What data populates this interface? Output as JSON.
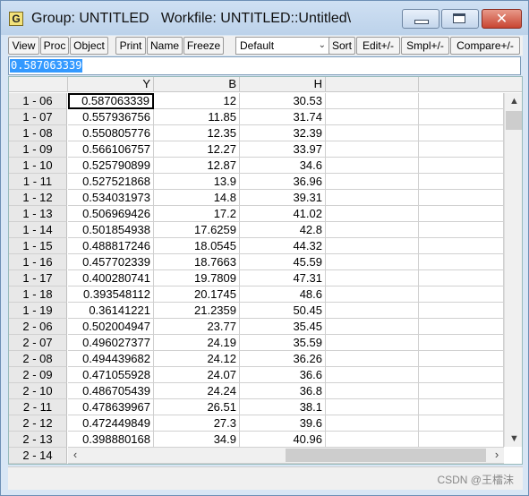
{
  "window": {
    "app_icon_letter": "G",
    "title": "Group: UNTITLED   Workfile: UNTITLED::Untitled\\"
  },
  "toolbar": {
    "buttons": [
      "View",
      "Proc",
      "Object",
      "Print",
      "Name",
      "Freeze",
      "Sort",
      "Edit+/-",
      "Smpl+/-",
      "Compare+/-"
    ],
    "dropdown_value": "Default"
  },
  "edit_line": {
    "value": "0.587063339"
  },
  "grid": {
    "columns": [
      "Y",
      "B",
      "H"
    ],
    "rows": [
      {
        "obs": "1 - 06",
        "y": "0.587063339",
        "b": "12",
        "h": "30.53"
      },
      {
        "obs": "1 - 07",
        "y": "0.557936756",
        "b": "11.85",
        "h": "31.74"
      },
      {
        "obs": "1 - 08",
        "y": "0.550805776",
        "b": "12.35",
        "h": "32.39"
      },
      {
        "obs": "1 - 09",
        "y": "0.566106757",
        "b": "12.27",
        "h": "33.97"
      },
      {
        "obs": "1 - 10",
        "y": "0.525790899",
        "b": "12.87",
        "h": "34.6"
      },
      {
        "obs": "1 - 11",
        "y": "0.527521868",
        "b": "13.9",
        "h": "36.96"
      },
      {
        "obs": "1 - 12",
        "y": "0.534031973",
        "b": "14.8",
        "h": "39.31"
      },
      {
        "obs": "1 - 13",
        "y": "0.506969426",
        "b": "17.2",
        "h": "41.02"
      },
      {
        "obs": "1 - 14",
        "y": "0.501854938",
        "b": "17.6259",
        "h": "42.8"
      },
      {
        "obs": "1 - 15",
        "y": "0.488817246",
        "b": "18.0545",
        "h": "44.32"
      },
      {
        "obs": "1 - 16",
        "y": "0.457702339",
        "b": "18.7663",
        "h": "45.59"
      },
      {
        "obs": "1 - 17",
        "y": "0.400280741",
        "b": "19.7809",
        "h": "47.31"
      },
      {
        "obs": "1 - 18",
        "y": "0.393548112",
        "b": "20.1745",
        "h": "48.6"
      },
      {
        "obs": "1 - 19",
        "y": "0.36141221",
        "b": "21.2359",
        "h": "50.45"
      },
      {
        "obs": "2 - 06",
        "y": "0.502004947",
        "b": "23.77",
        "h": "35.45"
      },
      {
        "obs": "2 - 07",
        "y": "0.496027377",
        "b": "24.19",
        "h": "35.59"
      },
      {
        "obs": "2 - 08",
        "y": "0.494439682",
        "b": "24.12",
        "h": "36.26"
      },
      {
        "obs": "2 - 09",
        "y": "0.471055928",
        "b": "24.07",
        "h": "36.6"
      },
      {
        "obs": "2 - 10",
        "y": "0.486705439",
        "b": "24.24",
        "h": "36.8"
      },
      {
        "obs": "2 - 11",
        "y": "0.478639967",
        "b": "26.51",
        "h": "38.1"
      },
      {
        "obs": "2 - 12",
        "y": "0.472449849",
        "b": "27.3",
        "h": "39.6"
      },
      {
        "obs": "2 - 13",
        "y": "0.398880168",
        "b": "34.9",
        "h": "40.96"
      },
      {
        "obs": "2 - 14",
        "y": "",
        "b": "",
        "h": ""
      }
    ]
  },
  "watermark": "CSDN @王檑沫",
  "colors": {
    "selection": "#3399ff",
    "title_bar": "#bcd2ea",
    "close_button": "#c84532"
  }
}
